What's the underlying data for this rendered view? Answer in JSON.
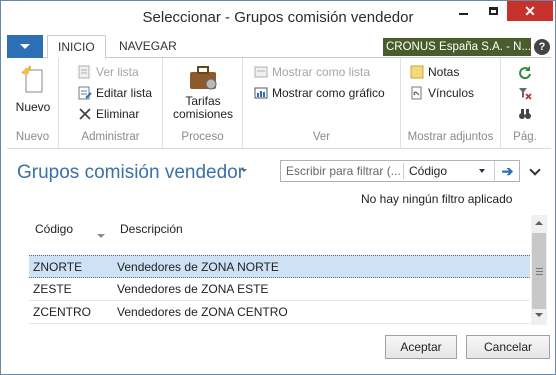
{
  "window": {
    "title": "Seleccionar - Grupos comisión vendedor",
    "close_color": "#c7312b"
  },
  "ribbon": {
    "tabs": [
      {
        "label": "INICIO",
        "active": true
      },
      {
        "label": "NAVEGAR",
        "active": false
      }
    ],
    "company": "CRONUS España S.A. - N...",
    "help_label": "?",
    "groups": {
      "nuevo": {
        "label": "Nuevo",
        "button": "Nuevo"
      },
      "administrar": {
        "label": "Administrar",
        "ver_lista": "Ver lista",
        "editar_lista": "Editar lista",
        "eliminar": "Eliminar"
      },
      "proceso": {
        "label": "Proceso",
        "tarifas_line1": "Tarifas",
        "tarifas_line2": "comisiones"
      },
      "ver": {
        "label": "Ver",
        "mostrar_lista": "Mostrar como lista",
        "mostrar_grafico": "Mostrar como gráfico"
      },
      "adjuntos": {
        "label": "Mostrar adjuntos",
        "notas": "Notas",
        "vinculos": "Vínculos"
      },
      "pag": {
        "label": "Pág."
      }
    }
  },
  "page": {
    "title": "Grupos comisión vendedor",
    "filter_placeholder": "Escribir para filtrar (...",
    "filter_field": "Código",
    "no_filter": "No hay ningún filtro aplicado"
  },
  "list": {
    "columns": [
      "Código",
      "Descripción"
    ],
    "rows": [
      {
        "code": "ZNORTE",
        "description": "Vendedores de ZONA NORTE",
        "selected": true
      },
      {
        "code": "ZESTE",
        "description": "Vendedores de ZONA ESTE",
        "selected": false
      },
      {
        "code": "ZCENTRO",
        "description": "Vendedores de ZONA CENTRO",
        "selected": false
      }
    ]
  },
  "footer": {
    "ok": "Aceptar",
    "cancel": "Cancelar"
  },
  "colors": {
    "accent": "#2c6fb4",
    "title_blue": "#3b70a8",
    "company_bg": "#4a5b2c",
    "selection": "#cfe1f4"
  }
}
